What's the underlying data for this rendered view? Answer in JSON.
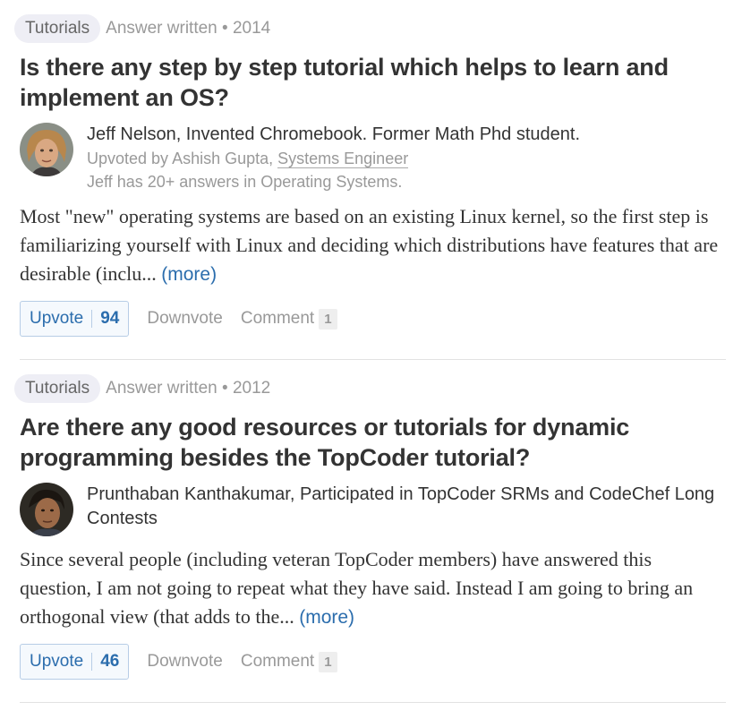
{
  "stories": [
    {
      "topic": "Tutorials",
      "written": "Answer written • 2014",
      "question": "Is there any step by step tutorial which helps to learn and implement an OS?",
      "author": "Jeff Nelson, Invented Chromebook. Former Math Phd student.",
      "upvoted_prefix": "Upvoted by Ashish Gupta,",
      "upvoted_job": "Systems Engineer",
      "answers_in": "Jeff has 20+ answers in Operating Systems.",
      "snippet": "Most \"new\" operating systems are based on an existing Linux kernel, so the first step is familiarizing yourself with Linux and deciding which   distributions have features that are desirable (inclu...",
      "more": "(more)",
      "upvote_label": "Upvote",
      "upvote_count": "94",
      "downvote_label": "Downvote",
      "comment_label": "Comment",
      "comment_count": "1"
    },
    {
      "topic": "Tutorials",
      "written": "Answer written • 2012",
      "question": "Are there any good resources or tutorials for dynamic programming besides the TopCoder tutorial?",
      "author": "Prunthaban Kanthakumar, Participated in TopCoder SRMs and CodeChef Long Contests",
      "snippet": "Since several people (including veteran TopCoder members) have answered this question, I am not going to repeat what they have said. Instead I am going to bring an orthogonal view (that adds to the...",
      "more": "(more)",
      "upvote_label": "Upvote",
      "upvote_count": "46",
      "downvote_label": "Downvote",
      "comment_label": "Comment",
      "comment_count": "1"
    }
  ]
}
